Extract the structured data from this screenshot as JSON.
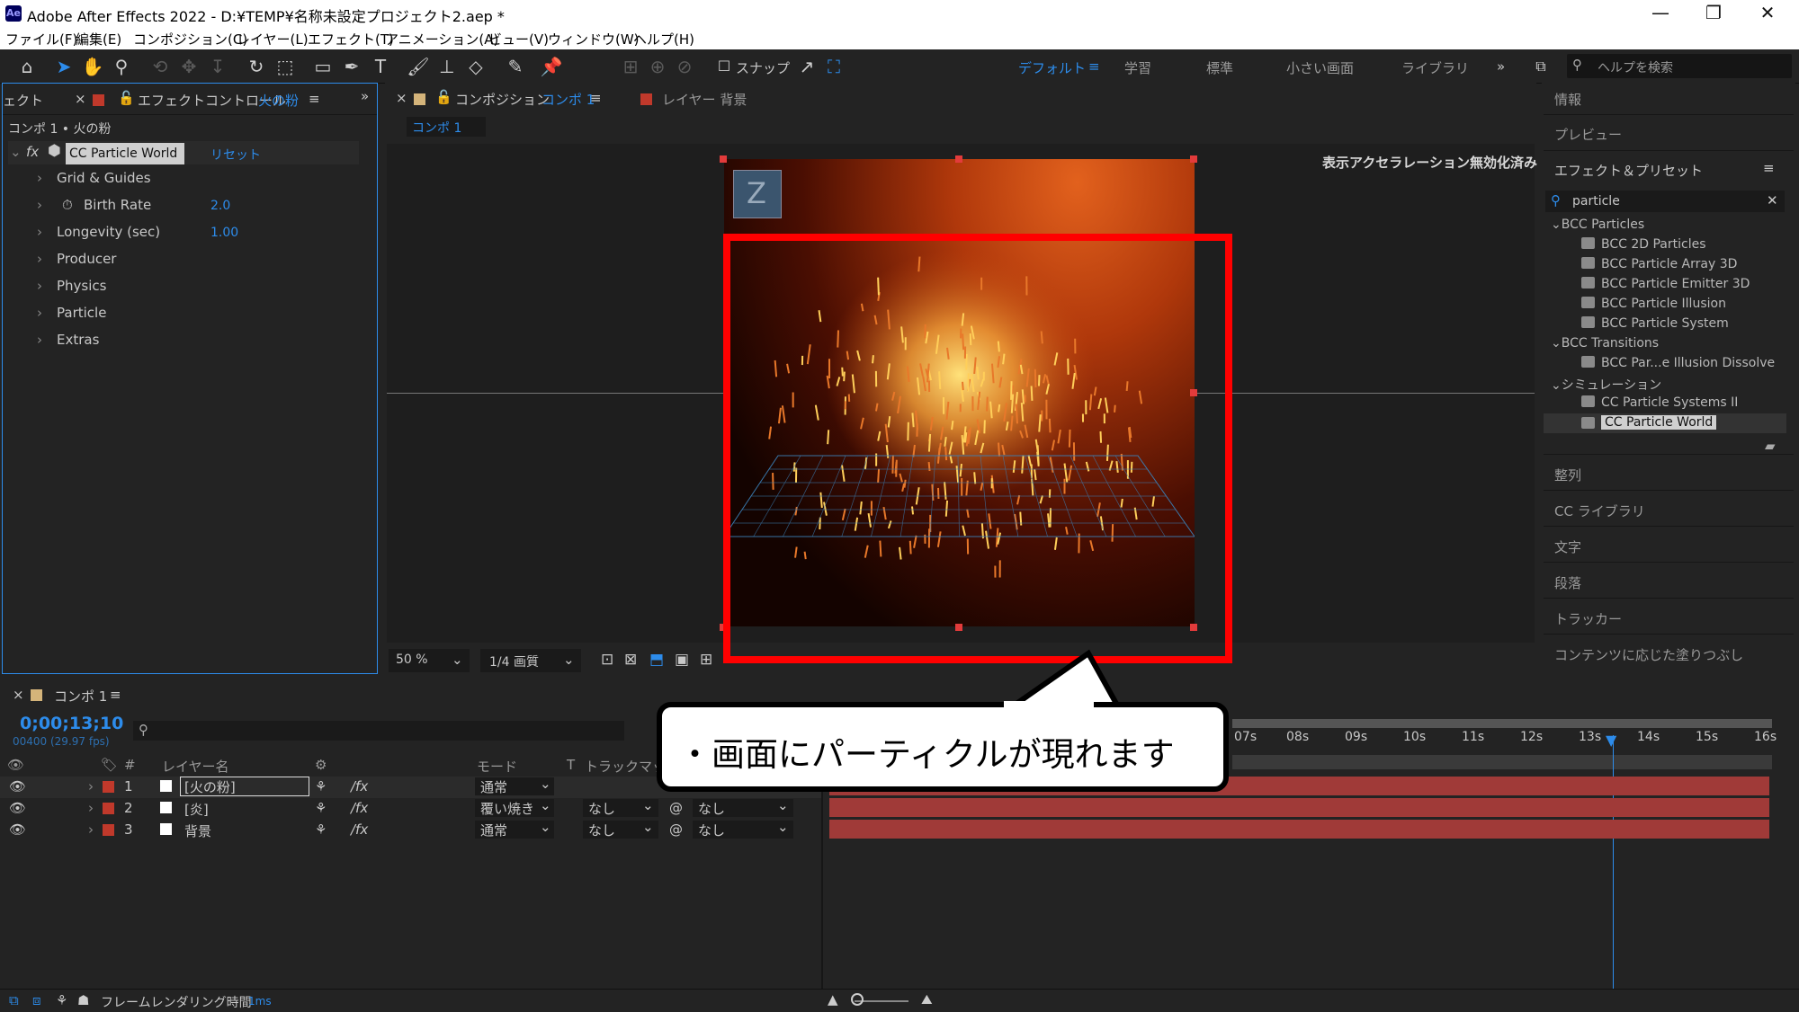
{
  "window": {
    "title": "Adobe After Effects 2022 - D:¥TEMP¥名称未設定プロジェクト2.aep *",
    "app_icon": "Ae"
  },
  "menu": [
    "ファイル(F)",
    "編集(E)",
    "コンポジション(C)",
    "レイヤー(L)",
    "エフェクト(T)",
    "アニメーション(A)",
    "ビュー(V)",
    "ウィンドウ(W)",
    "ヘルプ(H)"
  ],
  "toolbar": {
    "snap_label": "スナップ",
    "workspaces": [
      "デフォルト",
      "学習",
      "標準",
      "小さい画面",
      "ライブラリ"
    ],
    "help_search_placeholder": "ヘルプを検索"
  },
  "effect_panel": {
    "left_tab_fragment": "ェクト",
    "tab_label": "エフェクトコントロール",
    "tab_layer": "火の粉",
    "breadcrumb": "コンポ 1 • 火の粉",
    "fx_label": "fx",
    "effect_name": "CC Particle World",
    "reset_label": "リセット",
    "properties": [
      {
        "name": "Grid & Guides",
        "value": ""
      },
      {
        "name": "Birth Rate",
        "value": "2.0",
        "stopwatch": true
      },
      {
        "name": "Longevity (sec)",
        "value": "1.00"
      },
      {
        "name": "Producer",
        "value": ""
      },
      {
        "name": "Physics",
        "value": ""
      },
      {
        "name": "Particle",
        "value": ""
      },
      {
        "name": "Extras",
        "value": ""
      }
    ]
  },
  "comp_panel": {
    "tab_label": "コンポジション",
    "tab_comp": "コンポ 1",
    "layer_tab": "レイヤー 背景",
    "subtab": "コンポ 1",
    "accel_notice": "表示アクセラレーション無効化済み",
    "zoom": "50 %",
    "quality": "1/4 画質"
  },
  "right_panel": {
    "info": "情報",
    "preview": "プレビュー",
    "effects_presets": "エフェクト＆プリセット",
    "search_value": "particle",
    "tree": [
      {
        "label": "BCC Particles",
        "level": 0
      },
      {
        "label": "BCC 2D Particles",
        "level": 1
      },
      {
        "label": "BCC Particle Array 3D",
        "level": 1
      },
      {
        "label": "BCC Particle Emitter 3D",
        "level": 1
      },
      {
        "label": "BCC Particle Illusion",
        "level": 1
      },
      {
        "label": "BCC Particle System",
        "level": 1
      },
      {
        "label": "BCC Transitions",
        "level": 0
      },
      {
        "label": "BCC Par...e Illusion Dissolve",
        "level": 1
      },
      {
        "label": "シミュレーション",
        "level": 0
      },
      {
        "label": "CC Particle Systems II",
        "level": 1
      },
      {
        "label": "CC Particle World",
        "level": 1,
        "selected": true
      }
    ],
    "sections": [
      "整列",
      "CC ライブラリ",
      "文字",
      "段落",
      "トラッカー",
      "コンテンツに応じた塗りつぶし"
    ]
  },
  "timeline": {
    "tab": "コンポ 1",
    "timecode": "0;00;13;10",
    "frame_info": "00400 (29.97 fps)",
    "col_layer_name": "レイヤー名",
    "col_mode": "モード",
    "col_t": "T",
    "col_trackmatte": "トラックマット",
    "ticks": [
      "07s",
      "08s",
      "09s",
      "10s",
      "11s",
      "12s",
      "13s",
      "14s",
      "15s",
      "16s"
    ],
    "layers": [
      {
        "num": "1",
        "name": "[火の粉]",
        "mode": "通常",
        "trackmatte": "",
        "parent": ""
      },
      {
        "num": "2",
        "name": "[炎]",
        "mode": "覆い焼き",
        "trackmatte": "なし",
        "parent": "なし"
      },
      {
        "num": "3",
        "name": "背景",
        "mode": "通常",
        "trackmatte": "なし",
        "parent": "なし"
      }
    ],
    "render_time_label": "フレームレンダリング時間",
    "render_time_value": "1ms"
  },
  "callout": {
    "text": "・画面にパーティクルが現れます"
  },
  "colors": {
    "accent": "#2d8ceb",
    "label_red": "#c0392b",
    "highlight": "#ff0000",
    "bar": "#a03a38"
  }
}
